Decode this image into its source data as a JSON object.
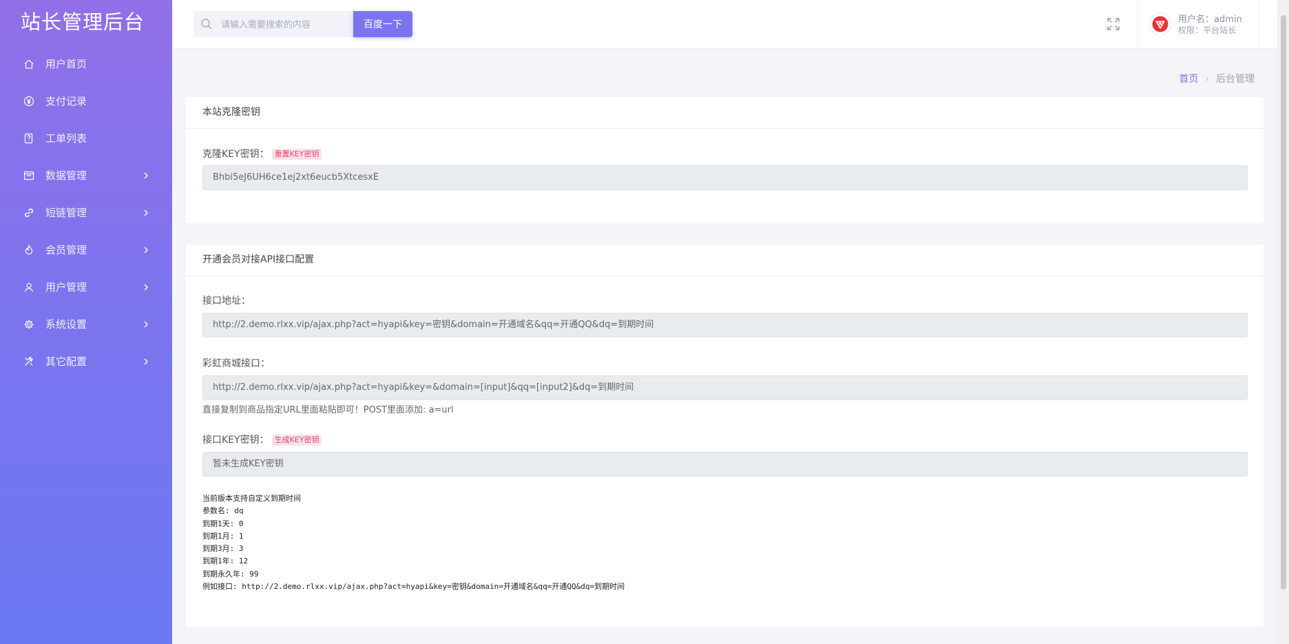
{
  "sidebar": {
    "brand": "站长管理后台",
    "items": [
      {
        "label": "用户首页",
        "icon": "home-icon",
        "has_arrow": false
      },
      {
        "label": "支付记录",
        "icon": "yen-icon",
        "has_arrow": false
      },
      {
        "label": "工单列表",
        "icon": "ticket-icon",
        "has_arrow": false
      },
      {
        "label": "数据管理",
        "icon": "window-icon",
        "has_arrow": true
      },
      {
        "label": "短链管理",
        "icon": "link-icon",
        "has_arrow": true
      },
      {
        "label": "会员管理",
        "icon": "flame-icon",
        "has_arrow": true
      },
      {
        "label": "用户管理",
        "icon": "user-icon",
        "has_arrow": true
      },
      {
        "label": "系统设置",
        "icon": "gear-icon",
        "has_arrow": true
      },
      {
        "label": "其它配置",
        "icon": "tools-icon",
        "has_arrow": true
      }
    ]
  },
  "topbar": {
    "search_placeholder": "请输入需要搜索的内容",
    "search_button": "百度一下",
    "user_name": "用户名：admin",
    "user_role": "权限：平台站长"
  },
  "breadcrumb": {
    "home": "首页",
    "current": "后台管理"
  },
  "clone_card": {
    "title": "本站克隆密钥",
    "key_label": "克隆KEY密钥：",
    "reset_tag": "重置KEY密钥",
    "key_value": "Bhbi5eJ6UH6ce1ej2xt6eucb5XtcesxE"
  },
  "api_card": {
    "title": "开通会员对接API接口配置",
    "address_label": "接口地址：",
    "address_value": "http://2.demo.rlxx.vip/ajax.php?act=hyapi&key=密钥&domain=开通域名&qq=开通QQ&dq=到期时间",
    "rainbow_label": "彩虹商城接口：",
    "rainbow_value": "http://2.demo.rlxx.vip/ajax.php?act=hyapi&key=&domain=[input]&qq=[input2]&dq=到期时间",
    "rainbow_hint": "直接复制到商品指定URL里面粘贴即可！POST里面添加: a=url",
    "key_label": "接口KEY密钥：",
    "generate_tag": "生成KEY密钥",
    "key_value": "暂未生成KEY密钥",
    "notes": "当前版本支持自定义到期时间\n参数名: dq\n到期1天: 0\n到期1月: 1\n到期3月: 3\n到期1年: 12\n到期永久年: 99\n例如接口: http://2.demo.rlxx.vip/ajax.php?act=hyapi&key=密钥&domain=开通域名&qq=开通QQ&dq=到期时间"
  },
  "colors": {
    "accent": "#7c74ef",
    "sidebar_top": "#9170e8",
    "sidebar_bottom": "#6b79f2",
    "tag_text": "#e5486f",
    "tag_bg": "#fde2e8",
    "readonly_bg": "#e9ecef",
    "page_bg": "#f4f5f9"
  }
}
